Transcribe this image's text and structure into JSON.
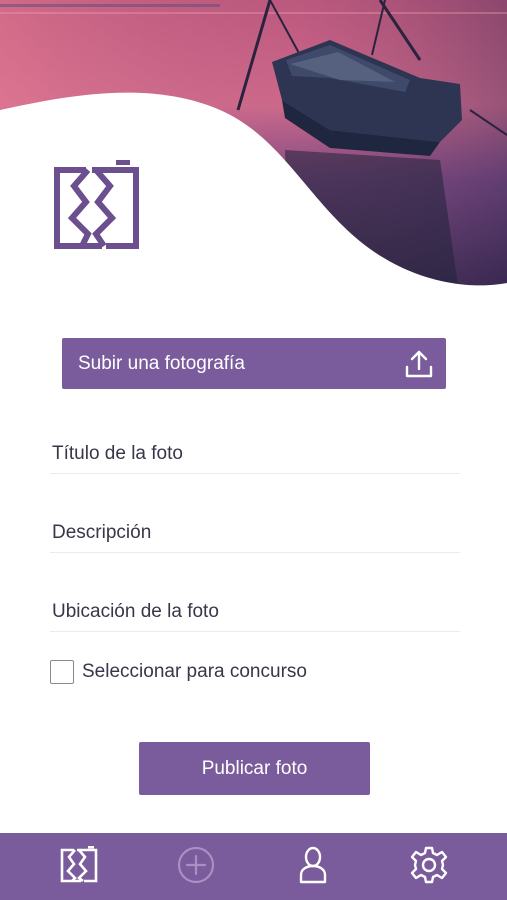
{
  "upload": {
    "label": "Subir una fotografía",
    "icon": "upload-icon"
  },
  "form": {
    "title_placeholder": "Título de la foto",
    "description_placeholder": "Descripción",
    "location_placeholder": "Ubicación de la foto"
  },
  "contest": {
    "label": "Seleccionar para concurso",
    "checked": false
  },
  "publish": {
    "label": "Publicar foto"
  },
  "nav": {
    "items": [
      {
        "icon": "app-logo-icon",
        "active": true
      },
      {
        "icon": "add-circle-icon",
        "active": false
      },
      {
        "icon": "user-icon",
        "active": false
      },
      {
        "icon": "gear-icon",
        "active": false
      }
    ]
  },
  "colors": {
    "accent": "#7a5c9c",
    "text": "#3a3548",
    "divider": "#ebebeb"
  }
}
